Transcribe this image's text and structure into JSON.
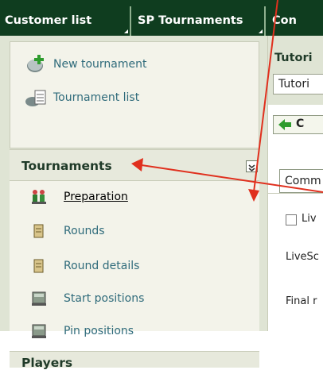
{
  "tabs": [
    {
      "label": "Customer list",
      "active": true
    },
    {
      "label": "SP Tournaments",
      "active": false
    },
    {
      "label": "Con",
      "active": false
    }
  ],
  "sidebar": {
    "top_items": [
      {
        "label": "New tournament",
        "icon": "add-tournament-icon"
      },
      {
        "label": "Tournament list",
        "icon": "tournament-list-icon"
      }
    ],
    "section_title": "Tournaments",
    "collapse_icon": "double-chevron-down-icon",
    "items": [
      {
        "label": "Preparation",
        "icon": "preparation-icon",
        "active": true
      },
      {
        "label": "Rounds",
        "icon": "rounds-icon"
      },
      {
        "label": "Round details",
        "icon": "round-details-icon"
      },
      {
        "label": "Start positions",
        "icon": "start-positions-icon"
      },
      {
        "label": "Pin positions",
        "icon": "pin-positions-icon"
      }
    ],
    "next_section_title": "Players"
  },
  "right_panel": {
    "title": "Tutori",
    "input_value": "Tutori",
    "button_label": "C",
    "tab_label": "Comm",
    "checkbox_label": "Liv",
    "label_1": "LiveSc",
    "label_2": "Final r"
  },
  "colors": {
    "topbar": "#0f3d1f",
    "panel_bg": "#dfe4d4",
    "link": "#2f6b7b",
    "annotation_arrow": "#e0301e"
  }
}
